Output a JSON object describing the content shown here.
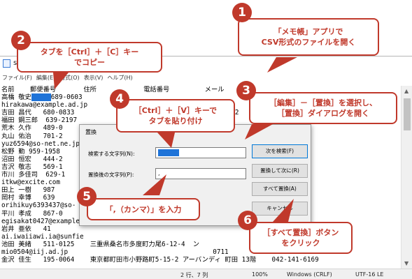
{
  "notepad": {
    "title": "sa",
    "menu": [
      "ファイル(F)",
      "編集(E)",
      "書式(O)",
      "表示(V)",
      "ヘルプ(H)"
    ],
    "lines": [
      {
        "text": "名前    郵便番号       住所            電話番号         メール"
      },
      {
        "before": "高橋 敬史",
        "selected": "tab",
        "after": "689-0603"
      },
      {
        "text": "hirakawa@example.ad.jp"
      },
      {
        "text": "吉田 昌代   680-0833                                   86-4012"
      },
      {
        "text": "福田 鋼三郎  639-2197"
      },
      {
        "text": "荒木 久作   489-0"
      },
      {
        "text": "丸山 佑治   701-2                                      00-net.ne.jp"
      },
      {
        "text": "yuz6594@so-net.ne.jp                                   086-425-6594"
      },
      {
        "text": "松野 勤 959-1958"
      },
      {
        "text": "沼田 恒宏   444-2                                      mbzmail.jp"
      },
      {
        "text": "吉沢 敬志   569-1                                      .numata@infoseek.jp"
      },
      {
        "text": "市川 多佳司  629-1                                     keizi@example.jp"
      },
      {
        "text": "itkw@excite.com                                        8951    tks-"
      },
      {
        "text": "田上 一樹   987"
      },
      {
        "text": "岡村 幸博   639                                        ikotih7014@example.org"
      },
      {
        "text": "orihikuy6393437@so-                                    0746-27-0165"
      },
      {
        "text": "平川 孝成   867-0"
      },
      {
        "text": "egisakat0427@example.n"
      },
      {
        "text": "岩井 亜依   41"
      },
      {
        "text": "ai.iwaiiawi.ia@sunfie"
      },
      {
        "text": "池田 美緒   511-0125    三重県桑名市多度町力尾6-12-4  ン"
      },
      {
        "text": "mio0504@iij.ad.jp                                     0711"
      },
      {
        "text": "金沢 佳生   195-0064    東京都町田市小野路町5-15-2 アーバンディ 町田 13階    042-141-6169"
      }
    ],
    "status": {
      "position": "2 行、7 列",
      "zoom": "100%",
      "eol": "Windows (CRLF)",
      "encoding": "UTF-16 LE"
    }
  },
  "dialog": {
    "title": "置換",
    "find_label": "検索する文字列(N):",
    "replace_label": "置換後の文字列(P):",
    "replace_value": ",",
    "buttons": {
      "find_next": "次を検索(F)",
      "replace": "置換して次に(R)",
      "replace_all": "すべて置換(A)",
      "cancel": "キャンセル"
    }
  },
  "callouts": [
    {
      "num": "1",
      "text": "「メモ帳」アプリで\nCSV形式のファイルを開く"
    },
    {
      "num": "2",
      "text": "タブを［Ctrl］＋［C］キー\nでコピー"
    },
    {
      "num": "3",
      "text": "［編集］－［置換］を選択し、\n［置換］ダイアログを開く"
    },
    {
      "num": "4",
      "text": "［Ctrl］＋［V］キーで\nタブを貼り付け"
    },
    {
      "num": "5",
      "text": "「,（カンマ）」を入力"
    },
    {
      "num": "6",
      "text": "［すべて置換］ボタン\nをクリック"
    }
  ],
  "colors": {
    "accent": "#c0392b",
    "selection": "#1e73d8"
  }
}
